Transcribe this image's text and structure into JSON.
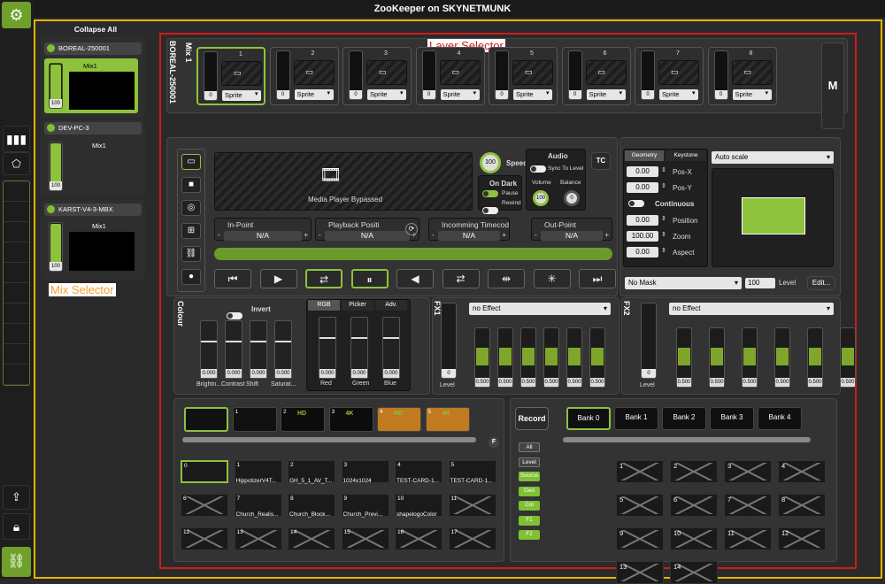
{
  "window": {
    "title": "ZooKeeper on SKYNETMUNK"
  },
  "annotations": {
    "layer_selector": "Layer Selector",
    "mix_selector": "Mix Selector"
  },
  "mix_selector": {
    "collapse_all": "Collapse All",
    "mixes": [
      {
        "name": "BOREAL-250001",
        "mix": "Mix1",
        "level": "100"
      },
      {
        "name": "DEV-PC-3",
        "mix": "Mix1",
        "level": "100"
      },
      {
        "name": "KARST-V4-3-MBX",
        "mix": "Mix1",
        "level": "100"
      }
    ]
  },
  "layer_bar": {
    "server": "BOREAL-250001",
    "mix": "Mix 1",
    "master_button": "M",
    "layers": [
      {
        "num": "1",
        "level": "0",
        "type": "Sprite"
      },
      {
        "num": "2",
        "level": "0",
        "type": "Sprite"
      },
      {
        "num": "3",
        "level": "0",
        "type": "Sprite"
      },
      {
        "num": "4",
        "level": "0",
        "type": "Sprite"
      },
      {
        "num": "5",
        "level": "0",
        "type": "Sprite"
      },
      {
        "num": "6",
        "level": "0",
        "type": "Sprite"
      },
      {
        "num": "7",
        "level": "0",
        "type": "Sprite"
      },
      {
        "num": "8",
        "level": "0",
        "type": "Sprite"
      }
    ]
  },
  "media": {
    "status": "Media Player Bypassed",
    "speed_value": "100",
    "speed_label": "Speed",
    "on_dark": "On Dark",
    "pause": "Pause",
    "rewind": "Rewind",
    "audio": "Audio",
    "sync_to_level": "Sync To Level",
    "volume": "Volume",
    "balance": "Balance",
    "volume_value": "100",
    "balance_value": "0",
    "tc": "TC",
    "in_point": "In-Point",
    "in_value": "N/A",
    "playback": "Playback Positi",
    "playback_value": "N/A",
    "incoming": "Incomming Timecod",
    "incoming_value": "N/A",
    "out_point": "Out-Point",
    "out_value": "N/A",
    "transport": [
      "⏮",
      "▶",
      "⇄",
      "⏸",
      "◀",
      "⇄",
      "⇹",
      "✳",
      "⏭"
    ]
  },
  "geometry": {
    "tab_geometry": "Geometry",
    "tab_keystone": "Keystone",
    "autoscale": "Auto scale",
    "pos_x": "0.00",
    "pos_x_label": "Pos-X",
    "pos_y": "0.00",
    "pos_y_label": "Pos-Y",
    "continuous": "Continuous",
    "position": "0.00",
    "position_label": "Position",
    "zoom": "100.00",
    "zoom_label": "Zoom",
    "aspect": "0.00",
    "aspect_label": "Aspect",
    "mask": "No Mask",
    "mask_level": "100",
    "level_label": "Level",
    "edit": "Edit..."
  },
  "colour": {
    "title": "Colour",
    "invert": "Invert",
    "sliders": [
      {
        "label": "Brightn...",
        "value": "0.000"
      },
      {
        "label": "Contrast",
        "value": "0.000"
      },
      {
        "label": "Shift",
        "value": "0.000"
      },
      {
        "label": "Saturat...",
        "value": "0.000"
      }
    ],
    "tabs": [
      "RGB",
      "Picker",
      "Adv."
    ],
    "rgb": [
      {
        "label": "Red",
        "value": "0.000"
      },
      {
        "label": "Green",
        "value": "0.000"
      },
      {
        "label": "Blue",
        "value": "0.000"
      }
    ]
  },
  "fx1": {
    "title": "FX1",
    "effect": "no Effect",
    "level_value": "0",
    "level_label": "Level",
    "params": [
      "0.500",
      "0.500",
      "0.500",
      "0.500",
      "0.500",
      "0.500"
    ]
  },
  "fx2": {
    "title": "FX2",
    "effect": "no Effect",
    "level_value": "0",
    "level_label": "Level",
    "params": [
      "0.500",
      "0.500",
      "0.500",
      "0.500",
      "0.500",
      "0.500"
    ]
  },
  "media_bank": {
    "top": [
      {
        "n": "",
        "t": ""
      },
      {
        "n": "1",
        "t": ""
      },
      {
        "n": "2",
        "t": "HD"
      },
      {
        "n": "3",
        "t": "4K"
      },
      {
        "n": "4",
        "t": "HD"
      },
      {
        "n": "5",
        "t": "4K"
      }
    ],
    "f_button": "F",
    "grid": [
      {
        "n": "0",
        "t": ""
      },
      {
        "n": "1",
        "t": "HippotizerV4T..."
      },
      {
        "n": "2",
        "t": "GH_5_1_AV_T..."
      },
      {
        "n": "3",
        "t": "1024x1024"
      },
      {
        "n": "4",
        "t": "TEST-CARD-1..."
      },
      {
        "n": "5",
        "t": "TEST-CARD-1..."
      },
      {
        "n": "6",
        "t": ""
      },
      {
        "n": "7",
        "t": "Church_Realis..."
      },
      {
        "n": "8",
        "t": "Church_Block..."
      },
      {
        "n": "9",
        "t": "Church_Previ..."
      },
      {
        "n": "10",
        "t": "shapelogoColor"
      },
      {
        "n": "11",
        "t": ""
      },
      {
        "n": "12",
        "t": ""
      },
      {
        "n": "13",
        "t": ""
      },
      {
        "n": "14",
        "t": ""
      },
      {
        "n": "15",
        "t": ""
      },
      {
        "n": "16",
        "t": ""
      },
      {
        "n": "17",
        "t": ""
      }
    ]
  },
  "presets": {
    "record": "Record",
    "filters": [
      "All",
      "Level",
      "Source",
      "Geo",
      "Col",
      "F1",
      "F2"
    ],
    "banks": [
      "Bank 0",
      "Bank 1",
      "Bank 2",
      "Bank 3",
      "Bank 4"
    ],
    "cells": [
      "1",
      "2",
      "3",
      "4",
      "5",
      "6",
      "7",
      "8",
      "9",
      "10",
      "11",
      "12",
      "13",
      "14"
    ]
  }
}
